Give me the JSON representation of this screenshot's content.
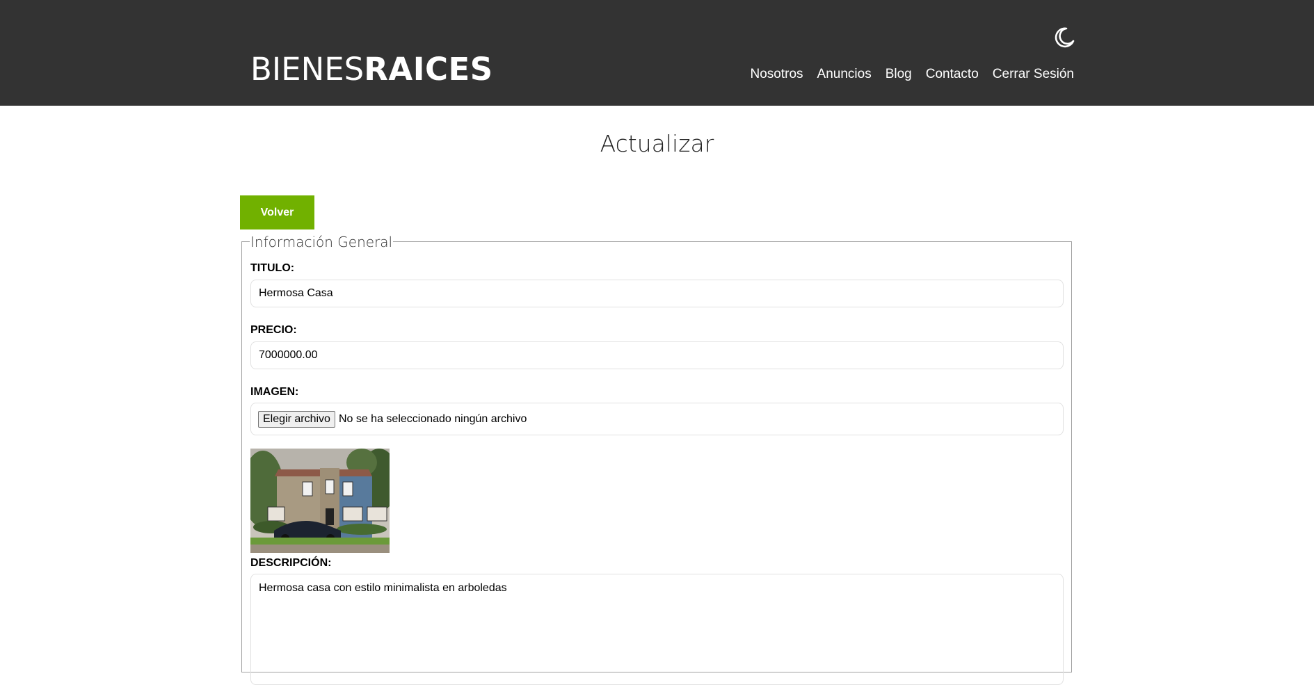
{
  "header": {
    "logo_light": "BIENES",
    "logo_bold": "RAICES",
    "theme_icon": "moon-icon",
    "nav": [
      {
        "label": "Nosotros"
      },
      {
        "label": "Anuncios"
      },
      {
        "label": "Blog"
      },
      {
        "label": "Contacto"
      },
      {
        "label": "Cerrar Sesión"
      }
    ]
  },
  "page": {
    "title": "Actualizar",
    "back_label": "Volver"
  },
  "form": {
    "legend": "Información General",
    "titulo_label": "TITULO:",
    "titulo_value": "Hermosa Casa",
    "precio_label": "PRECIO:",
    "precio_value": "7000000.00",
    "imagen_label": "IMAGEN:",
    "file_button": "Elegir archivo",
    "file_status": "No se ha seleccionado ningún archivo",
    "descripcion_label": "DESCRIPCIÓN:",
    "descripcion_value": "Hermosa casa con estilo minimalista en arboledas"
  },
  "colors": {
    "header_bg": "#333333",
    "accent": "#71b100"
  }
}
